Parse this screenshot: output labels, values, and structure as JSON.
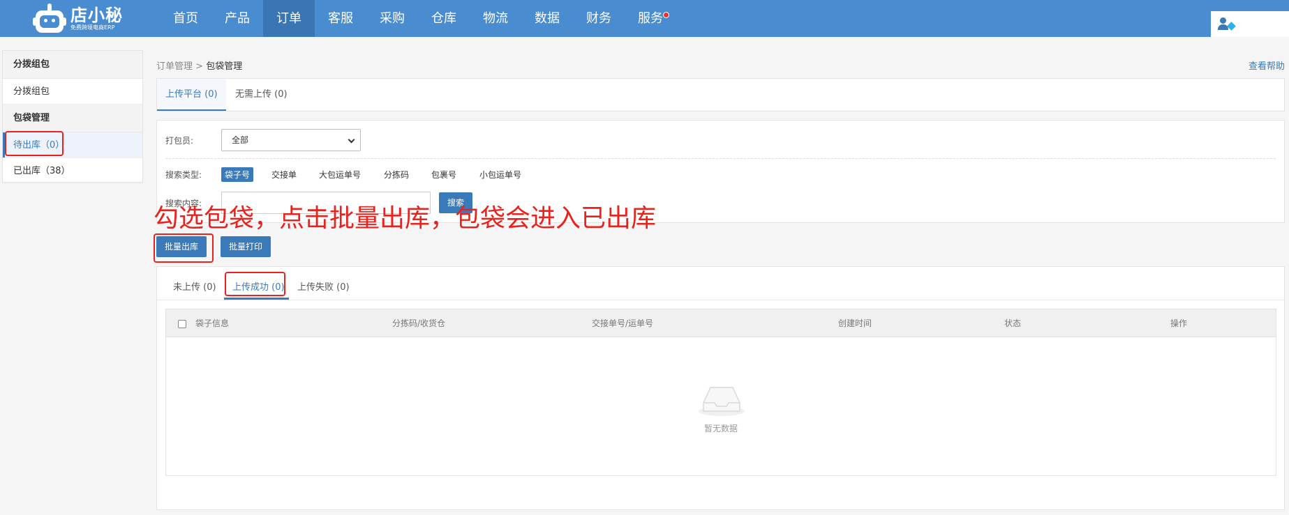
{
  "brand": {
    "name": "店小秘",
    "tagline": "免费跨境电商ERP"
  },
  "nav": [
    {
      "label": "首页"
    },
    {
      "label": "产品"
    },
    {
      "label": "订单"
    },
    {
      "label": "客服"
    },
    {
      "label": "采购"
    },
    {
      "label": "仓库"
    },
    {
      "label": "物流"
    },
    {
      "label": "数据"
    },
    {
      "label": "财务"
    },
    {
      "label": "服务"
    }
  ],
  "sidebar": {
    "groups": [
      {
        "title": "分拨组包",
        "items": [
          {
            "label": "分拨组包"
          }
        ]
      },
      {
        "title": "包袋管理",
        "items": [
          {
            "label": "待出库（0）"
          },
          {
            "label": "已出库（38）"
          }
        ]
      }
    ]
  },
  "breadcrumb": {
    "parent": "订单管理",
    "current": "包袋管理"
  },
  "help_link": "查看帮助",
  "platform_tabs": [
    {
      "label": "上传平台 (0)"
    },
    {
      "label": "无需上传 (0)"
    }
  ],
  "filter": {
    "packer_label": "打包员:",
    "packer_value": "全部",
    "search_type_label": "搜索类型:",
    "search_types": [
      "袋子号",
      "交接单",
      "大包运单号",
      "分拣码",
      "包裹号",
      "小包运单号"
    ],
    "search_content_label": "搜索内容:",
    "search_value": "",
    "search_button": "搜索"
  },
  "annotation": "勾选包袋，点击批量出库，包袋会进入已出库",
  "actions": {
    "batch_outbound": "批量出库",
    "batch_print": "批量打印"
  },
  "status_tabs": [
    {
      "label": "未上传 (0)"
    },
    {
      "label": "上传成功 (0)"
    },
    {
      "label": "上传失败 (0)"
    }
  ],
  "table": {
    "columns": [
      "袋子信息",
      "分拣码/收货仓",
      "交接单号/运单号",
      "创建时间",
      "状态",
      "操作"
    ],
    "empty_text": "暂无数据"
  },
  "colors": {
    "primary": "#3a7ab8",
    "topbar": "#4a8cd0",
    "annotation_red": "#e8231e"
  }
}
